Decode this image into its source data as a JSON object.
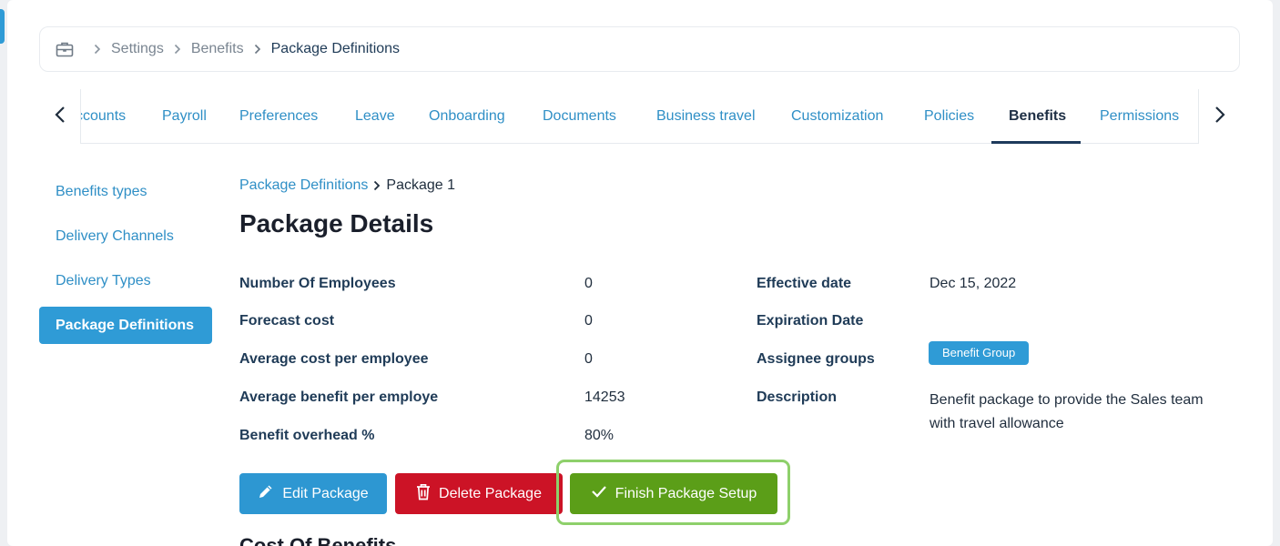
{
  "breadcrumb": {
    "home_icon": "briefcase-icon",
    "items": [
      "Settings",
      "Benefits"
    ],
    "current": "Package Definitions"
  },
  "tabs": {
    "items": [
      {
        "label": "ccounts",
        "active": false
      },
      {
        "label": "Payroll",
        "active": false
      },
      {
        "label": "Preferences",
        "active": false
      },
      {
        "label": "Leave",
        "active": false
      },
      {
        "label": "Onboarding",
        "active": false
      },
      {
        "label": "Documents",
        "active": false
      },
      {
        "label": "Business travel",
        "active": false
      },
      {
        "label": "Customization",
        "active": false
      },
      {
        "label": "Policies",
        "active": false
      },
      {
        "label": "Benefits",
        "active": true
      },
      {
        "label": "Permissions",
        "active": false
      }
    ]
  },
  "side_nav": {
    "items": [
      {
        "label": "Benefits types",
        "active": false
      },
      {
        "label": "Delivery Channels",
        "active": false
      },
      {
        "label": "Delivery Types",
        "active": false
      },
      {
        "label": "Package Definitions",
        "active": true
      }
    ]
  },
  "sub_breadcrumb": {
    "parent": "Package Definitions",
    "current": "Package 1"
  },
  "page_title": "Package Details",
  "details_left": [
    {
      "label": "Number Of Employees",
      "value": "0"
    },
    {
      "label": "Forecast cost",
      "value": "0"
    },
    {
      "label": "Average cost per employee",
      "value": "0"
    },
    {
      "label": "Average benefit per employe",
      "value": "14253"
    },
    {
      "label": "Benefit overhead %",
      "value": "80%"
    }
  ],
  "details_right": {
    "effective_date_label": "Effective date",
    "effective_date_value": "Dec 15, 2022",
    "expiration_date_label": "Expiration Date",
    "expiration_date_value": "",
    "assignee_groups_label": "Assignee groups",
    "assignee_badge": "Benefit Group",
    "description_label": "Description",
    "description_value": "Benefit package to provide the Sales team with travel allowance"
  },
  "actions": {
    "edit_label": "Edit Package",
    "delete_label": "Delete Package",
    "finish_label": "Finish Package Setup"
  },
  "next_section_title": "Cost Of Benefits",
  "colors": {
    "accent": "#2f9bd6",
    "danger": "#cc1326",
    "success": "#5b9e18",
    "focus_ring": "#8ed06b"
  }
}
